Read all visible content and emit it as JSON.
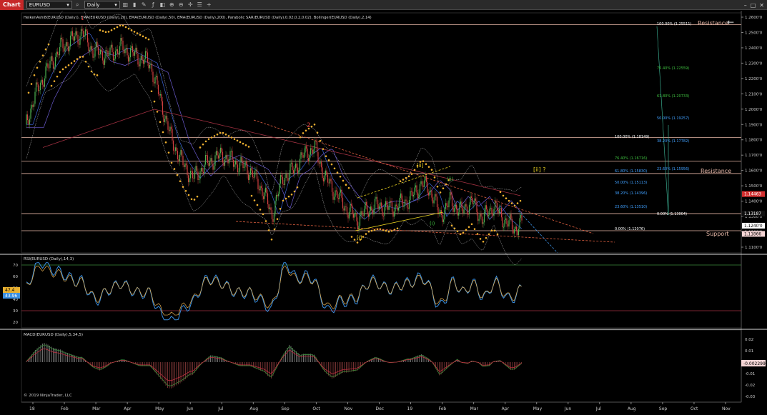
{
  "toolbar": {
    "chart_label": "Chart",
    "instrument": "EURUSD",
    "period": "Daily",
    "icons": [
      "search-icon",
      "chevron-down-icon",
      "chevron-down-icon",
      "bar-style-icon",
      "candle-style-icon",
      "drawing-icon",
      "indicators-icon",
      "strategies-icon",
      "zoom-in-icon",
      "zoom-out-icon",
      "crosshair-icon",
      "properties-icon",
      "add-icon"
    ],
    "right_icons": [
      "minimize-icon",
      "maximize-icon",
      "close-icon"
    ]
  },
  "colors": {
    "background": "#000000",
    "candle_up": "#4caf50",
    "candle_down": "#d04040",
    "sar": "#f0b030",
    "ema20": "#3b63d6",
    "ema50": "#6a5acd",
    "ema200": "#a03040",
    "bollinger": "#bbbbbb",
    "hline": "#e8b8a8",
    "trend_red": "#e06040",
    "trend_yellow": "#e8d020",
    "rsi": "#3a8fe0"
  },
  "price_panel": {
    "indicator_label": "HeikenAshi8(EURUSD (Daily)), EMA(EURUSD (Daily),20), EMA(EURUSD (Daily),50), EMA(EURUSD (Daily),200), Parabolic SAR(EURUSD (Daily),0.02,0.2,0.02), Bollinger(EURUSD (Daily),2,14)",
    "y_ticks": [
      "1.2600'0",
      "1.2500'0",
      "1.2400'0",
      "1.2300'0",
      "1.2200'0",
      "1.2100'0",
      "1.2000'0",
      "1.1900'0",
      "1.1800'0",
      "1.1700'0",
      "1.1600'0",
      "1.1500'0",
      "1.1400'0",
      "1.1300'0",
      "1.1200'0",
      "1.1100'0"
    ],
    "y_values": [
      1.26,
      1.25,
      1.24,
      1.23,
      1.22,
      1.21,
      1.2,
      1.19,
      1.18,
      1.17,
      1.16,
      1.15,
      1.14,
      1.13,
      1.12,
      1.11
    ],
    "price_tags": [
      {
        "label": "1.14463",
        "value": 1.14463,
        "bg": "#d32f2f",
        "fg": "#ffffff"
      },
      {
        "label": "1.13187",
        "value": 1.13187,
        "bg": "#111111",
        "fg": "#ffffff"
      },
      {
        "label": "1.1240'0",
        "value": 1.124,
        "bg": "#ffffff",
        "fg": "#000000"
      },
      {
        "label": "1.11866",
        "value": 1.11866,
        "bg": "#f5d5d5",
        "fg": "#000000"
      }
    ],
    "horizontal_levels": [
      1.2551,
      1.18149,
      1.166,
      1.158,
      1.13187,
      1.1207
    ],
    "labels": {
      "resistance_top": "Resistance",
      "resistance_mid": "Resistance",
      "support": "Support",
      "wave_1": "1",
      "wave_2": "2",
      "wave_i_bracket": "[i]",
      "wave_ii_bracket": "[ii]",
      "wave_ii_q": "[ii] ?",
      "wave_i_small": "(i)",
      "wave_ii_small": "(ii)"
    },
    "fib_left": [
      "100.00% (1.18149)",
      "76.40% (1.16716)",
      "61.80% (1.15830)",
      "50.00% (1.15113)",
      "38.20% (1.14396)",
      "23.60% (1.13510)",
      "0.00% (1.13004)",
      "0.00% (1.12076)"
    ],
    "fib_right": [
      "100.00% (1.25511)",
      "76.40% (1.22559)",
      "61.80% (1.20733)",
      "50.00% (1.19257)",
      "38.20% (1.17782)",
      "23.60% (1.15956)"
    ]
  },
  "rsi_panel": {
    "label": "RSI(EURUSD (Daily),14,3)",
    "y_ticks": [
      "70",
      "60",
      "50",
      "40",
      "30",
      "20"
    ],
    "tags": [
      "47.4",
      "43.96"
    ]
  },
  "macd_panel": {
    "label": "MACD(EURUSD (Daily),5,34,5)",
    "y_ticks": [
      "0.02",
      "0.01",
      "0",
      "-0.01",
      "-0.02",
      "-0.03"
    ],
    "tag": "-0.002299",
    "copyright": "© 2019 NinjaTrader, LLC"
  },
  "x_axis": {
    "labels": [
      "18",
      "Feb",
      "Mar",
      "Apr",
      "May",
      "Jun",
      "Jul",
      "Aug",
      "Sep",
      "Oct",
      "Nov",
      "Dec",
      "19",
      "Feb",
      "Mar",
      "Apr",
      "May",
      "Jun",
      "Jul",
      "Aug",
      "Sep",
      "Oct",
      "Nov"
    ]
  }
}
